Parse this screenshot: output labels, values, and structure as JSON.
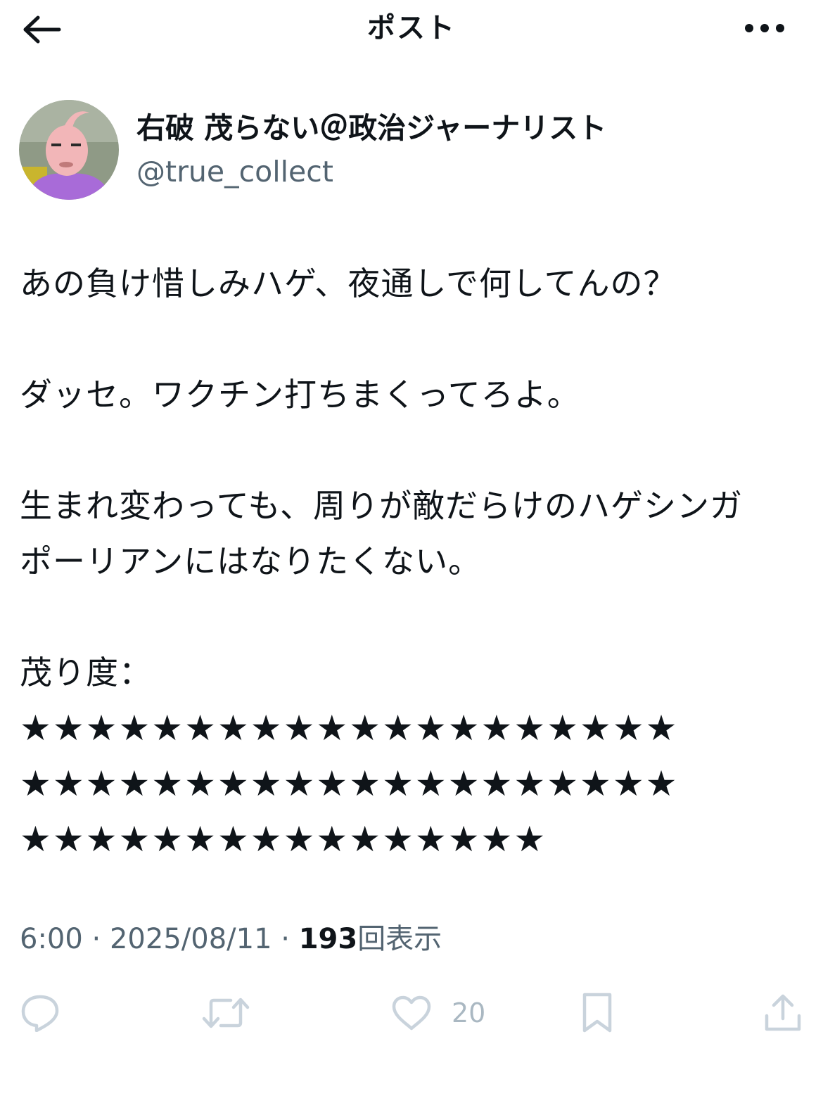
{
  "header": {
    "title": "ポスト",
    "back_icon": "arrow-left-icon",
    "more_icon": "more-horizontal-icon"
  },
  "author": {
    "display_name": "右破 茂らない＠政治ジャーナリスト",
    "handle": "@true_collect"
  },
  "tweet": {
    "paragraphs": [
      "あの負け惜しみハゲ、夜通しで何してんの？",
      "ダッセ。ワクチン打ちまくってろよ。",
      "生まれ変わっても、周りが敵だらけのハゲシンガ",
      "ポーリアンにはなりたくない。",
      "茂り度：",
      "★★★★★★★★★★★★★★★★★★★★",
      "★★★★★★★★★★★★★★★★★★★★",
      "★★★★★★★★★★★★★★★★"
    ]
  },
  "meta": {
    "time": "6:00",
    "sep": " · ",
    "date": "2025/08/11",
    "views_count": "193",
    "views_label": "回表示"
  },
  "actions": {
    "like_count": "20",
    "icons": [
      "reply-icon",
      "repost-icon",
      "like-icon",
      "bookmark-icon",
      "share-icon"
    ]
  },
  "colors": {
    "text": "#0f1419",
    "secondary": "#536471",
    "action_icon": "#c9d3dc"
  }
}
